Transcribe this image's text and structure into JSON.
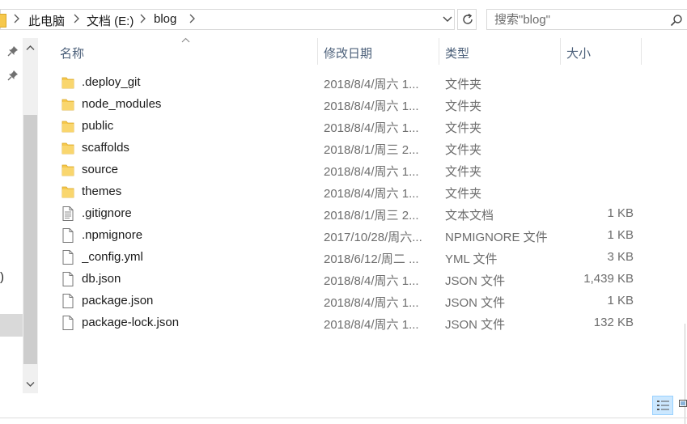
{
  "address": {
    "crumbs": [
      "此电脑",
      "文档 (E:)",
      "blog"
    ]
  },
  "search": {
    "placeholder": "搜索\"blog\""
  },
  "nav": {
    "partial_text": ")"
  },
  "columns": {
    "name": "名称",
    "date": "修改日期",
    "type": "类型",
    "size": "大小"
  },
  "files": [
    {
      "name": ".deploy_git",
      "date": "2018/8/4/周六 1...",
      "type": "文件夹",
      "size": "",
      "icon": "folder-icon"
    },
    {
      "name": "node_modules",
      "date": "2018/8/4/周六 1...",
      "type": "文件夹",
      "size": "",
      "icon": "folder-icon"
    },
    {
      "name": "public",
      "date": "2018/8/4/周六 1...",
      "type": "文件夹",
      "size": "",
      "icon": "folder-icon"
    },
    {
      "name": "scaffolds",
      "date": "2018/8/1/周三 2...",
      "type": "文件夹",
      "size": "",
      "icon": "folder-icon"
    },
    {
      "name": "source",
      "date": "2018/8/4/周六 1...",
      "type": "文件夹",
      "size": "",
      "icon": "folder-icon"
    },
    {
      "name": "themes",
      "date": "2018/8/4/周六 1...",
      "type": "文件夹",
      "size": "",
      "icon": "folder-icon"
    },
    {
      "name": ".gitignore",
      "date": "2018/8/1/周三 2...",
      "type": "文本文档",
      "size": "1 KB",
      "icon": "text-document-icon"
    },
    {
      "name": ".npmignore",
      "date": "2017/10/28/周六...",
      "type": "NPMIGNORE 文件",
      "size": "1 KB",
      "icon": "file-icon"
    },
    {
      "name": "_config.yml",
      "date": "2018/6/12/周二 ...",
      "type": "YML 文件",
      "size": "3 KB",
      "icon": "file-icon"
    },
    {
      "name": "db.json",
      "date": "2018/8/4/周六 1...",
      "type": "JSON 文件",
      "size": "1,439 KB",
      "icon": "file-icon"
    },
    {
      "name": "package.json",
      "date": "2018/8/4/周六 1...",
      "type": "JSON 文件",
      "size": "1 KB",
      "icon": "file-icon"
    },
    {
      "name": "package-lock.json",
      "date": "2018/8/4/周六 1...",
      "type": "JSON 文件",
      "size": "132 KB",
      "icon": "file-icon"
    }
  ],
  "colors": {
    "folder": "#f6c84c",
    "header_text": "#4c607a",
    "secondary_text": "#6d6d6d",
    "selected_view": "#cce8ff"
  }
}
